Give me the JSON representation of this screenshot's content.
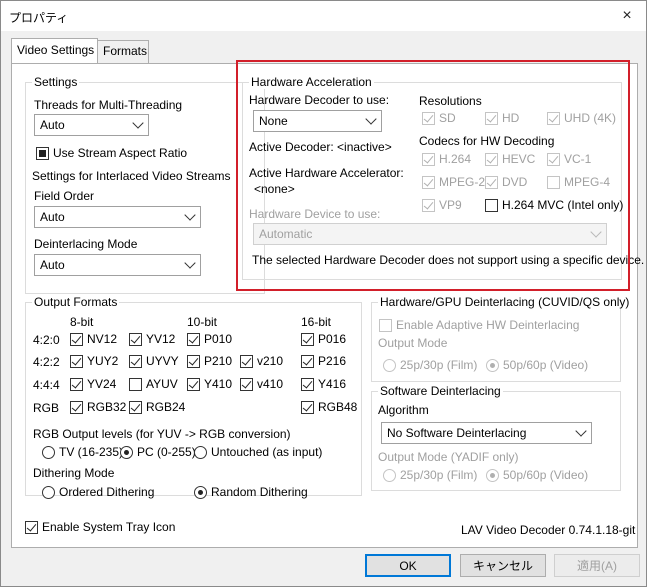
{
  "window": {
    "title": "プロパティ",
    "close_icon": "×"
  },
  "tabs": [
    {
      "label": "Video Settings"
    },
    {
      "label": "Formats"
    }
  ],
  "settings": {
    "group": "Settings",
    "threads_label": "Threads for Multi-Threading",
    "threads_value": "Auto",
    "stream_aspect": "Use Stream Aspect Ratio",
    "interlaced_label": "Settings for Interlaced Video Streams",
    "field_order_label": "Field Order",
    "field_order_value": "Auto",
    "deint_mode_label": "Deinterlacing Mode",
    "deint_mode_value": "Auto"
  },
  "hwaccel": {
    "group": "Hardware Acceleration",
    "decoder_label": "Hardware Decoder to use:",
    "decoder_value": "None",
    "active_decoder": "Active Decoder:  <inactive>",
    "active_accel_label": "Active Hardware Accelerator:",
    "active_accel_value": "<none>",
    "device_label": "Hardware Device to use:",
    "device_value": "Automatic",
    "note": "The selected Hardware Decoder does not support using a specific device.",
    "resolutions_label": "Resolutions",
    "resolutions": [
      {
        "label": "SD",
        "checked": true
      },
      {
        "label": "HD",
        "checked": true
      },
      {
        "label": "UHD (4K)",
        "checked": true
      }
    ],
    "codecs_label": "Codecs for HW Decoding",
    "codecs": [
      {
        "label": "H.264",
        "checked": true
      },
      {
        "label": "HEVC",
        "checked": true
      },
      {
        "label": "VC-1",
        "checked": true
      },
      {
        "label": "MPEG-2",
        "checked": true
      },
      {
        "label": "DVD",
        "checked": true
      },
      {
        "label": "MPEG-4",
        "checked": false
      },
      {
        "label": "VP9",
        "checked": true
      },
      {
        "label": "H.264 MVC (Intel only)",
        "checked": false
      }
    ]
  },
  "output_formats": {
    "group": "Output Formats",
    "headers": [
      "8-bit",
      "10-bit",
      "16-bit"
    ],
    "rows": [
      {
        "label": "4:2:0",
        "items": [
          "NV12",
          "YV12",
          "P010",
          "",
          "P016"
        ]
      },
      {
        "label": "4:2:2",
        "items": [
          "YUY2",
          "UYVY",
          "P210",
          "v210",
          "P216"
        ]
      },
      {
        "label": "4:4:4",
        "items": [
          "YV24",
          "AYUV",
          "Y410",
          "v410",
          "Y416"
        ]
      },
      {
        "label": "RGB",
        "items": [
          "RGB32",
          "RGB24",
          "",
          "",
          "RGB48"
        ]
      }
    ],
    "levels_label": "RGB Output levels (for YUV -> RGB conversion)",
    "levels": [
      "TV (16-235)",
      "PC (0-255)",
      "Untouched (as input)"
    ],
    "dither_label": "Dithering Mode",
    "dither": [
      "Ordered Dithering",
      "Random Dithering"
    ]
  },
  "hw_deint": {
    "group": "Hardware/GPU Deinterlacing (CUVID/QS only)",
    "enable": "Enable Adaptive HW Deinterlacing",
    "output_mode": "Output Mode",
    "opt1": "25p/30p (Film)",
    "opt2": "50p/60p (Video)"
  },
  "sw_deint": {
    "group": "Software Deinterlacing",
    "algorithm_label": "Algorithm",
    "algorithm_value": "No Software Deinterlacing",
    "output_mode": "Output Mode (YADIF only)",
    "opt1": "25p/30p (Film)",
    "opt2": "50p/60p (Video)"
  },
  "footer": {
    "tray": "Enable System Tray Icon",
    "version": "LAV Video Decoder 0.74.1.18-git"
  },
  "buttons": {
    "ok": "OK",
    "cancel": "キャンセル",
    "apply": "適用(A)"
  }
}
